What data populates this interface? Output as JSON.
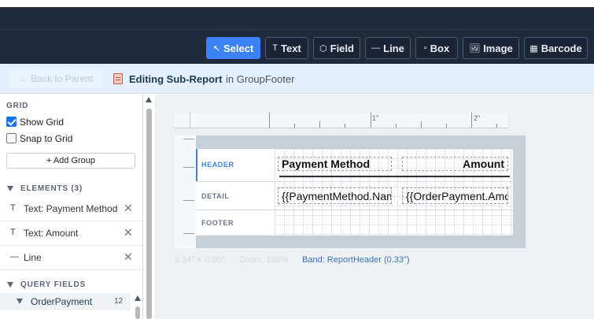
{
  "toolbar": {
    "tools": [
      {
        "icon": "↖",
        "label": "Select",
        "active": true
      },
      {
        "icon": "T",
        "label": "Text"
      },
      {
        "icon": "⬡",
        "label": "Field"
      },
      {
        "icon": "—",
        "label": "Line"
      },
      {
        "icon": "▫",
        "label": "Box"
      },
      {
        "icon": "🖼",
        "label": "Image"
      },
      {
        "icon": "▦",
        "label": "Barcode"
      }
    ]
  },
  "subbar": {
    "back_label": "← Back to Parent",
    "title": "Editing Sub-Report",
    "context": "in GroupFooter"
  },
  "sidebar": {
    "grid_label": "GRID",
    "show_grid_label": "Show Grid",
    "show_grid_checked": true,
    "snap_label": "Snap to Grid",
    "snap_checked": false,
    "add_group_label": "+ Add Group",
    "elements_label": "ELEMENTS (3)",
    "elements": [
      {
        "type": "T",
        "label": "Text: Payment Method"
      },
      {
        "type": "T",
        "label": "Text: Amount"
      },
      {
        "type": "—",
        "label": "Line"
      }
    ],
    "query_fields_label": "QUERY FIELDS",
    "query_field": {
      "label": "OrderPayment",
      "count": "12"
    }
  },
  "ruler": {
    "marks": [
      "1\"",
      "2\""
    ]
  },
  "bands": {
    "header": "HEADER",
    "detail": "DETAIL",
    "footer": "FOOTER"
  },
  "report": {
    "header_left": "Payment Method",
    "header_right": "Amount",
    "detail_left": "{{PaymentMethod.Name}}",
    "detail_right": "{{OrderPayment.Amount}}"
  },
  "status": {
    "size": "2.34\" × 0.90\"",
    "zoom": "Zoom: 180%",
    "band": "Band: ReportHeader (0.33\")"
  },
  "colors": {
    "accent": "#3b82f6",
    "toolbar_bg": "#1f2a3b",
    "subbar_bg": "#e3f0fb"
  }
}
